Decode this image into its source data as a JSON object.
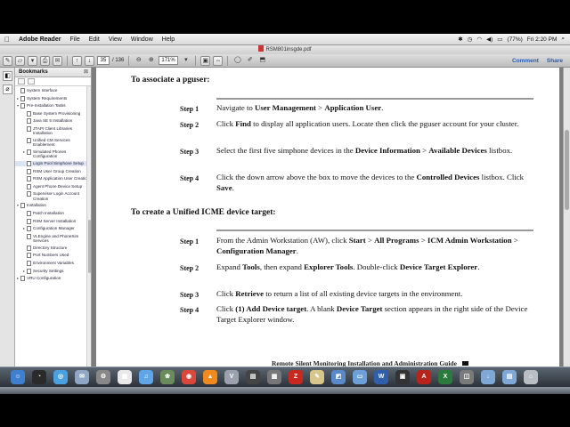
{
  "menubar": {
    "app": "Adobe Reader",
    "items": [
      "File",
      "Edit",
      "View",
      "Window",
      "Help"
    ],
    "battery": "(77%)",
    "clock": "Fri 2:20 PM"
  },
  "window": {
    "title": "RSM801insgde.pdf"
  },
  "toolbar": {
    "page_current": "35",
    "page_total": "/ 136",
    "zoom": "171%",
    "comment": "Comment",
    "share": "Share"
  },
  "bookmarks": {
    "title": "Bookmarks",
    "items": [
      {
        "label": "System Interface",
        "depth": 1,
        "twisty": ""
      },
      {
        "label": "System Requirements",
        "depth": 1,
        "twisty": "▸"
      },
      {
        "label": "Pre-Installation Tasks",
        "depth": 1,
        "twisty": "▾"
      },
      {
        "label": "Base System Provisioning",
        "depth": 2,
        "twisty": ""
      },
      {
        "label": "Java SE 5 Installation",
        "depth": 2,
        "twisty": ""
      },
      {
        "label": "JTAPI Client Libraries Installation",
        "depth": 2,
        "twisty": ""
      },
      {
        "label": "Unified CM Services Enablement",
        "depth": 2,
        "twisty": ""
      },
      {
        "label": "Simulated Phones Configuration",
        "depth": 2,
        "twisty": "▸"
      },
      {
        "label": "Login Pool Simphone Setup",
        "depth": 2,
        "twisty": "",
        "selected": true
      },
      {
        "label": "RSM User Group Creation",
        "depth": 2,
        "twisty": ""
      },
      {
        "label": "RSM Application User Creation",
        "depth": 2,
        "twisty": ""
      },
      {
        "label": "Agent Phone Device Setup",
        "depth": 2,
        "twisty": ""
      },
      {
        "label": "Supervisor Login Account Creation",
        "depth": 2,
        "twisty": ""
      },
      {
        "label": "Installation",
        "depth": 1,
        "twisty": "▾"
      },
      {
        "label": "Patch Installation",
        "depth": 2,
        "twisty": ""
      },
      {
        "label": "RSM Server Installation",
        "depth": 2,
        "twisty": ""
      },
      {
        "label": "Configuration Manager",
        "depth": 2,
        "twisty": "▸"
      },
      {
        "label": "VLEngine and PhoneSim Services",
        "depth": 2,
        "twisty": ""
      },
      {
        "label": "Directory Structure",
        "depth": 2,
        "twisty": ""
      },
      {
        "label": "Port Numbers Used",
        "depth": 2,
        "twisty": ""
      },
      {
        "label": "Environment Variables",
        "depth": 2,
        "twisty": ""
      },
      {
        "label": "Security Settings",
        "depth": 2,
        "twisty": "▸"
      },
      {
        "label": "VRU Configuration",
        "depth": 1,
        "twisty": "▸"
      }
    ]
  },
  "document": {
    "section1_title": "To associate a pguser:",
    "section1_steps": [
      {
        "label": "Step 1",
        "html": "Navigate to <b>User Management</b> &gt; <b>Application User</b>."
      },
      {
        "label": "Step 2",
        "html": "Click <b>Find</b> to display all application users. Locate then click the pguser account for your cluster."
      },
      {
        "label": "Step 3",
        "html": "Select the first five simphone devices in the <b>Device Information</b> &gt; <b>Available Devices</b> listbox."
      },
      {
        "label": "Step 4",
        "html": "Click the down arrow above the box to move the devices to the <b>Controlled Devices</b> listbox. Click <b>Save</b>."
      }
    ],
    "section2_title": "To create a Unified ICME device target:",
    "section2_steps": [
      {
        "label": "Step 1",
        "html": "From the Admin Workstation (AW), click <b>Start</b> &gt; <b>All Programs</b> &gt; <b>ICM Admin Workstation</b> &gt; <b>Configuration Manager</b>."
      },
      {
        "label": "Step 2",
        "html": "Expand <b>Tools</b>, then expand <b>Explorer Tools</b>. Double-click <b>Device Target Explorer</b>."
      },
      {
        "label": "Step 3",
        "html": "Click <b>Retrieve</b> to return a list of all existing device targets in the environment."
      },
      {
        "label": "Step 4",
        "html": "Click <b>(1) Add Device target</b>. A blank <b>Device Target</b> section appears in the right side of the Device Target Explorer window."
      }
    ],
    "footer": "Remote Silent Monitoring Installation and Administration Guide"
  },
  "dock": {
    "icons": [
      {
        "name": "finder-icon",
        "color": "#3f7fd0",
        "glyph": "☺"
      },
      {
        "name": "dashboard-icon",
        "color": "#2a2a2a",
        "glyph": "◔"
      },
      {
        "name": "safari-icon",
        "color": "#4aa0e0",
        "glyph": "◎"
      },
      {
        "name": "mail-icon",
        "color": "#8fa6c4",
        "glyph": "✉"
      },
      {
        "name": "system-prefs-icon",
        "color": "#888888",
        "glyph": "⚙"
      },
      {
        "name": "ical-icon",
        "color": "#e9e9e9",
        "glyph": "▦"
      },
      {
        "name": "itunes-icon",
        "color": "#5fa5e8",
        "glyph": "♫"
      },
      {
        "name": "iphoto-icon",
        "color": "#6a8c5a",
        "glyph": "❀"
      },
      {
        "name": "chrome-icon",
        "color": "#d9483b",
        "glyph": "◉"
      },
      {
        "name": "vlc-icon",
        "color": "#f08a1c",
        "glyph": "▲"
      },
      {
        "name": "vmware-icon",
        "color": "#9aa3ad",
        "glyph": "V"
      },
      {
        "name": "terminal-icon",
        "color": "#444444",
        "glyph": "▤"
      },
      {
        "name": "calculator-icon",
        "color": "#777777",
        "glyph": "▦"
      },
      {
        "name": "filezilla-icon",
        "color": "#c8281f",
        "glyph": "Z"
      },
      {
        "name": "textedit-icon",
        "color": "#d8c58a",
        "glyph": "✎"
      },
      {
        "name": "preview-icon",
        "color": "#5a89c9",
        "glyph": "◩"
      },
      {
        "name": "folder-icon",
        "color": "#6d9fd9",
        "glyph": "▭"
      },
      {
        "name": "word-icon",
        "color": "#2f5fad",
        "glyph": "W"
      },
      {
        "name": "console-icon",
        "color": "#333333",
        "glyph": "▣"
      },
      {
        "name": "acrobat-icon",
        "color": "#b8231b",
        "glyph": "A"
      },
      {
        "name": "excel-icon",
        "color": "#2b7a3e",
        "glyph": "X"
      },
      {
        "name": "capture-icon",
        "color": "#7a7a7a",
        "glyph": "◫"
      },
      {
        "name": "downloads-folder-icon",
        "color": "#7fa8d6",
        "glyph": "↓"
      },
      {
        "name": "documents-folder-icon",
        "color": "#7fa8d6",
        "glyph": "▤"
      },
      {
        "name": "trash-icon",
        "color": "#b9bec5",
        "glyph": "⌂"
      }
    ]
  }
}
